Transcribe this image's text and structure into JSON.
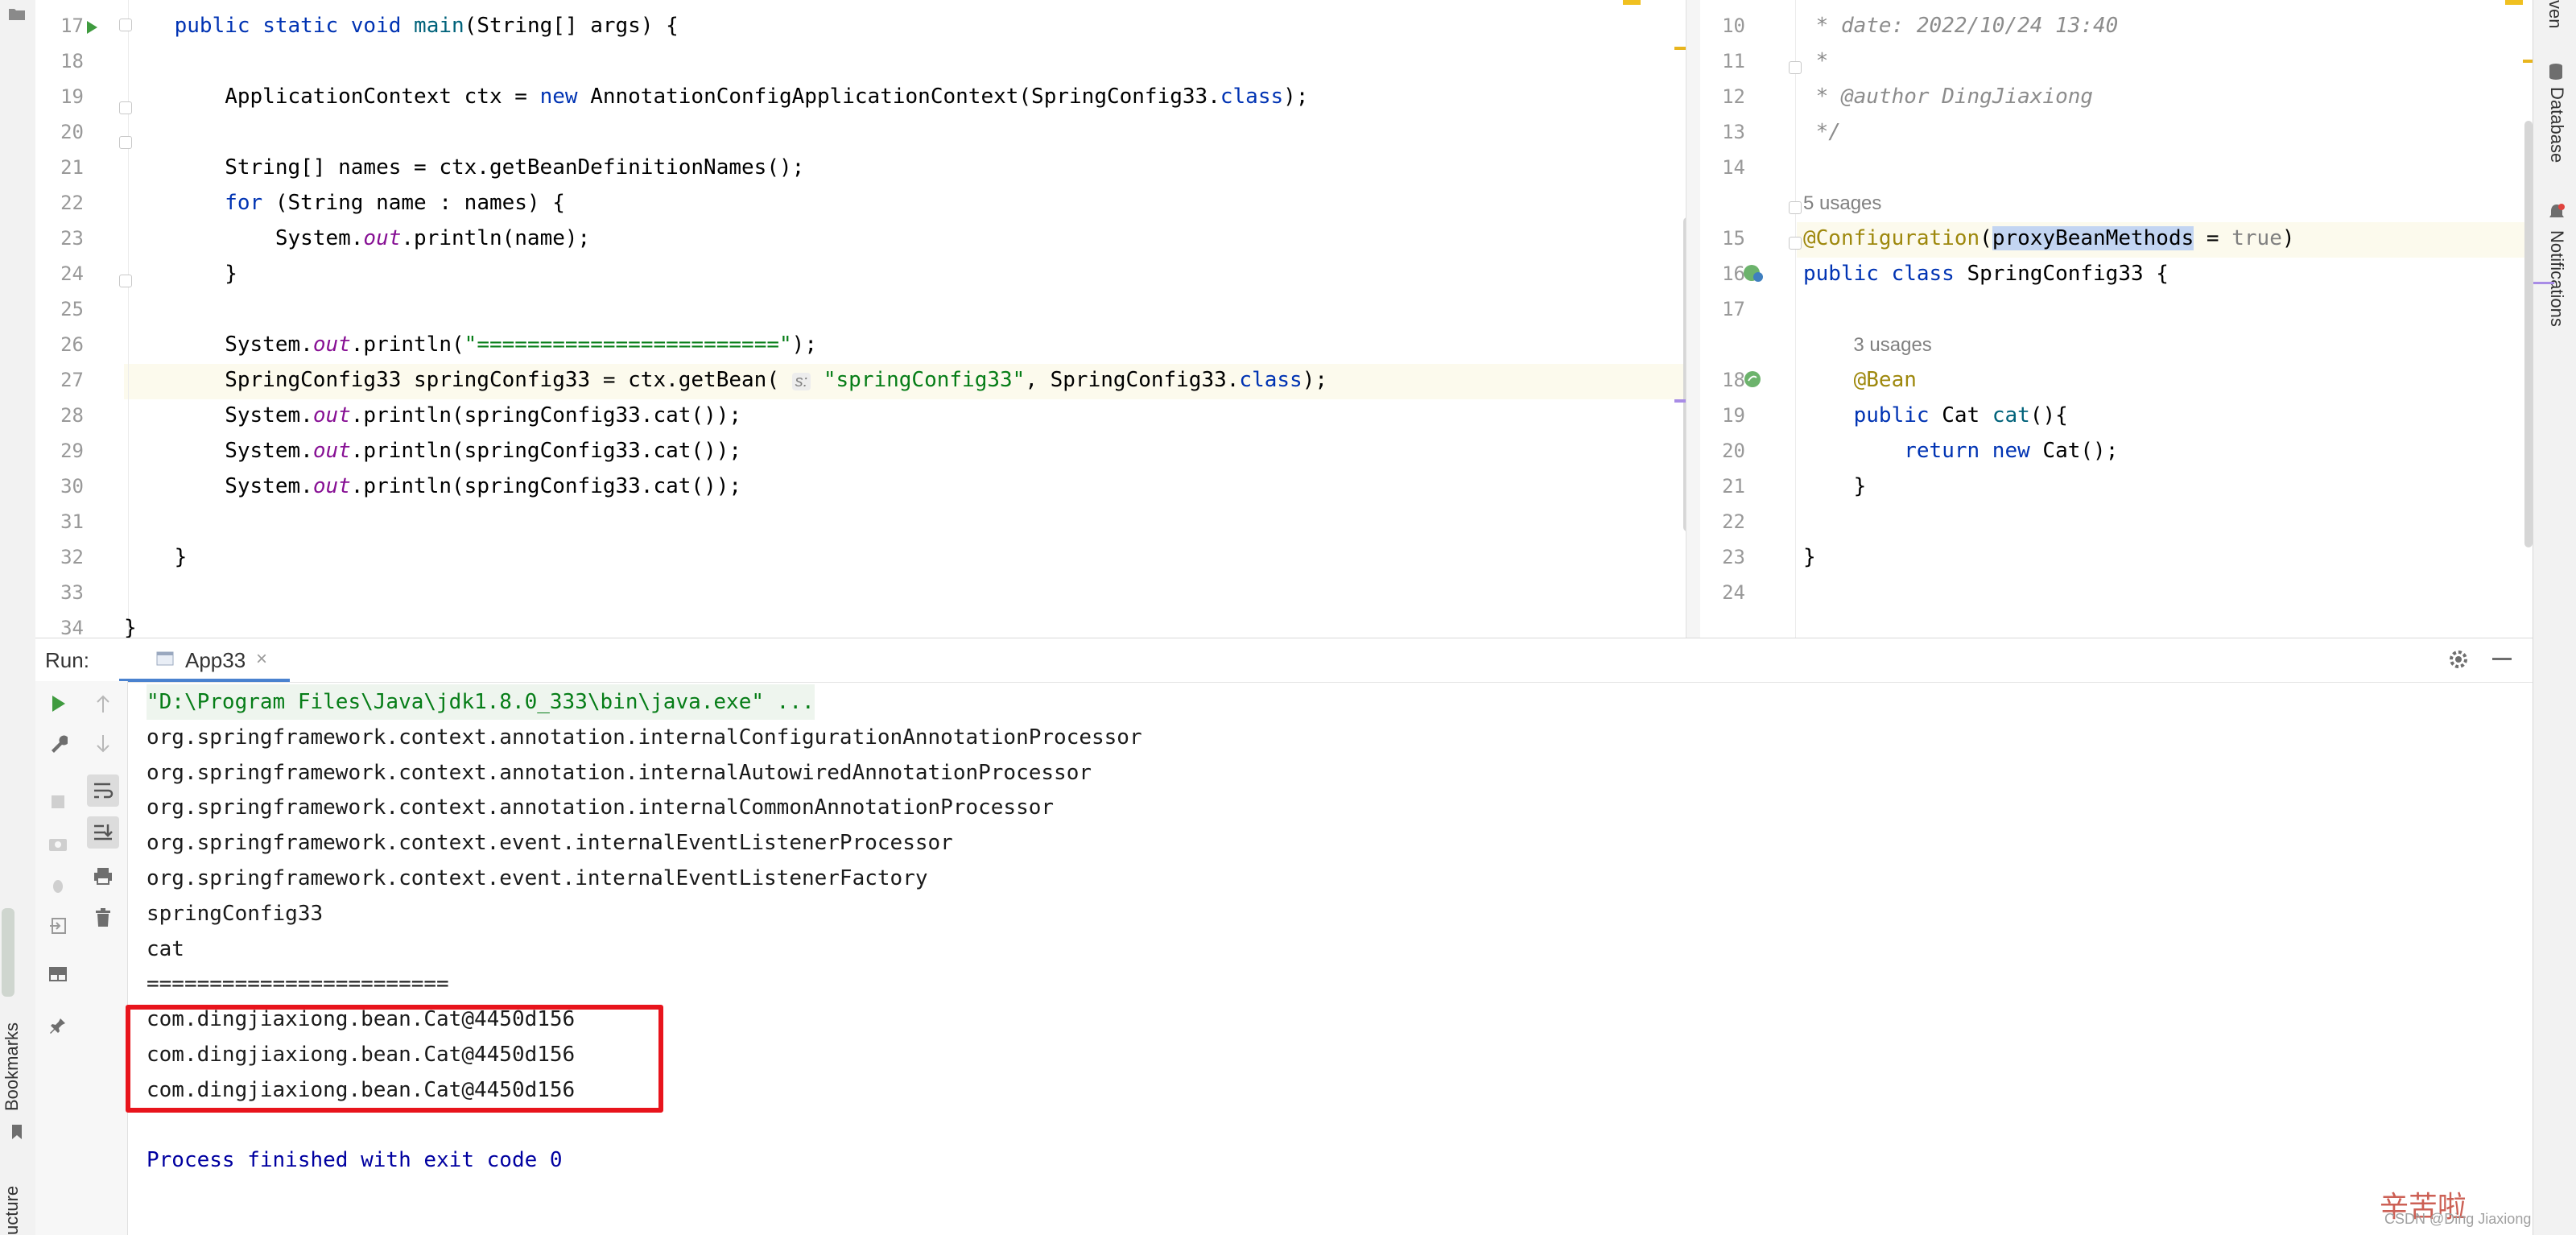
{
  "left_editor": {
    "lines": [
      {
        "n": "17",
        "parts": [
          [
            "    ",
            ""
          ],
          [
            "public static void ",
            "kw"
          ],
          [
            "main",
            "method"
          ],
          [
            "(String[] args) {",
            ""
          ]
        ]
      },
      {
        "n": "18",
        "parts": []
      },
      {
        "n": "19",
        "parts": [
          [
            "        ApplicationContext ctx = ",
            ""
          ],
          [
            "new ",
            "kw"
          ],
          [
            "AnnotationConfigApplicationContext(SpringConfig33.",
            ""
          ],
          [
            "class",
            "kw"
          ],
          [
            ");",
            ""
          ]
        ]
      },
      {
        "n": "20",
        "parts": []
      },
      {
        "n": "21",
        "parts": [
          [
            "        String[] names = ctx.getBeanDefinitionNames();",
            ""
          ]
        ]
      },
      {
        "n": "22",
        "parts": [
          [
            "        ",
            ""
          ],
          [
            "for ",
            "kw"
          ],
          [
            "(String name : names) {",
            ""
          ]
        ]
      },
      {
        "n": "23",
        "parts": [
          [
            "            System.",
            ""
          ],
          [
            "out",
            "field"
          ],
          [
            ".println(name);",
            ""
          ]
        ]
      },
      {
        "n": "24",
        "parts": [
          [
            "        }",
            ""
          ]
        ]
      },
      {
        "n": "25",
        "parts": []
      },
      {
        "n": "26",
        "parts": [
          [
            "        System.",
            ""
          ],
          [
            "out",
            "field"
          ],
          [
            ".println(",
            ""
          ],
          [
            "\"========================\"",
            "str"
          ],
          [
            ");",
            ""
          ]
        ]
      },
      {
        "n": "27",
        "parts": [
          [
            "        SpringConfig33 springConfig33 = ctx.getBean( ",
            ""
          ],
          [
            "s:",
            "hint"
          ],
          [
            " ",
            ""
          ],
          [
            "\"springConfig33\"",
            "str"
          ],
          [
            ", SpringConfig33.",
            ""
          ],
          [
            "class",
            "kw"
          ],
          [
            ");",
            ""
          ]
        ]
      },
      {
        "n": "28",
        "parts": [
          [
            "        System.",
            ""
          ],
          [
            "out",
            "field"
          ],
          [
            ".println(springConfig33.cat());",
            ""
          ]
        ]
      },
      {
        "n": "29",
        "parts": [
          [
            "        System.",
            ""
          ],
          [
            "out",
            "field"
          ],
          [
            ".println(springConfig33.cat());",
            ""
          ]
        ]
      },
      {
        "n": "30",
        "parts": [
          [
            "        System.",
            ""
          ],
          [
            "out",
            "field"
          ],
          [
            ".println(springConfig33.cat());",
            ""
          ]
        ]
      },
      {
        "n": "31",
        "parts": []
      },
      {
        "n": "32",
        "parts": [
          [
            "    }",
            ""
          ]
        ]
      },
      {
        "n": "33",
        "parts": []
      },
      {
        "n": "34",
        "parts": [
          [
            "}",
            ""
          ]
        ]
      }
    ]
  },
  "right_editor": {
    "lines": [
      {
        "n": "10",
        "parts": [
          [
            " * date: 2022/10/24 13:40",
            "comment"
          ]
        ]
      },
      {
        "n": "11",
        "parts": [
          [
            " *",
            "comment"
          ]
        ]
      },
      {
        "n": "12",
        "parts": [
          [
            " * ",
            "comment"
          ],
          [
            "@author",
            "comment"
          ],
          [
            " DingJiaxiong",
            "comment"
          ]
        ]
      },
      {
        "n": "13",
        "parts": [
          [
            " */",
            "comment"
          ]
        ]
      },
      {
        "n": "14",
        "parts": []
      },
      {
        "n": "",
        "usages": "5 usages"
      },
      {
        "n": "15",
        "parts": [
          [
            "@Configuration",
            "ann"
          ],
          [
            "(",
            ""
          ],
          [
            "proxyBeanMethods",
            "sel"
          ],
          [
            " = ",
            ""
          ],
          [
            "true",
            "kw2"
          ],
          [
            ")",
            ""
          ]
        ]
      },
      {
        "n": "16",
        "parts": [
          [
            "public class ",
            "kw"
          ],
          [
            "SpringConfig33 {",
            ""
          ]
        ]
      },
      {
        "n": "17",
        "parts": []
      },
      {
        "n": "",
        "usages": "    3 usages"
      },
      {
        "n": "18",
        "parts": [
          [
            "    ",
            ""
          ],
          [
            "@Bean",
            "ann"
          ]
        ]
      },
      {
        "n": "19",
        "parts": [
          [
            "    ",
            ""
          ],
          [
            "public ",
            "kw"
          ],
          [
            "Cat ",
            ""
          ],
          [
            "cat",
            "method"
          ],
          [
            "(){",
            ""
          ]
        ]
      },
      {
        "n": "20",
        "parts": [
          [
            "        ",
            ""
          ],
          [
            "return new ",
            "kw"
          ],
          [
            "Cat();",
            ""
          ]
        ]
      },
      {
        "n": "21",
        "parts": [
          [
            "    }",
            ""
          ]
        ]
      },
      {
        "n": "22",
        "parts": []
      },
      {
        "n": "23",
        "parts": [
          [
            "}",
            ""
          ]
        ]
      },
      {
        "n": "24",
        "parts": []
      }
    ]
  },
  "run_panel": {
    "label": "Run:",
    "tab_label": "App33",
    "console_lines": [
      {
        "text": "\"D:\\Program Files\\Java\\jdk1.8.0_333\\bin\\java.exe\" ...",
        "style": "cmd"
      },
      {
        "text": "org.springframework.context.annotation.internalConfigurationAnnotationProcessor",
        "style": ""
      },
      {
        "text": "org.springframework.context.annotation.internalAutowiredAnnotationProcessor",
        "style": ""
      },
      {
        "text": "org.springframework.context.annotation.internalCommonAnnotationProcessor",
        "style": ""
      },
      {
        "text": "org.springframework.context.event.internalEventListenerProcessor",
        "style": ""
      },
      {
        "text": "org.springframework.context.event.internalEventListenerFactory",
        "style": ""
      },
      {
        "text": "springConfig33",
        "style": ""
      },
      {
        "text": "cat",
        "style": ""
      },
      {
        "text": "========================",
        "style": ""
      },
      {
        "text": "com.dingjiaxiong.bean.Cat@4450d156",
        "style": ""
      },
      {
        "text": "com.dingjiaxiong.bean.Cat@4450d156",
        "style": ""
      },
      {
        "text": "com.dingjiaxiong.bean.Cat@4450d156",
        "style": ""
      },
      {
        "text": "",
        "style": ""
      },
      {
        "text": "Process finished with exit code 0",
        "style": "exit"
      }
    ]
  },
  "side_tabs": {
    "database": "Database",
    "notifications": "Notifications",
    "bookmarks": "Bookmarks",
    "structure": "ucture",
    "top_partial": "ven"
  },
  "watermark": {
    "stamp": "辛苦啦",
    "credit": "CSDN @Ding Jiaxiong"
  },
  "colors": {
    "highlight_box": "#e8141c",
    "current_line": "#fcfaed"
  }
}
